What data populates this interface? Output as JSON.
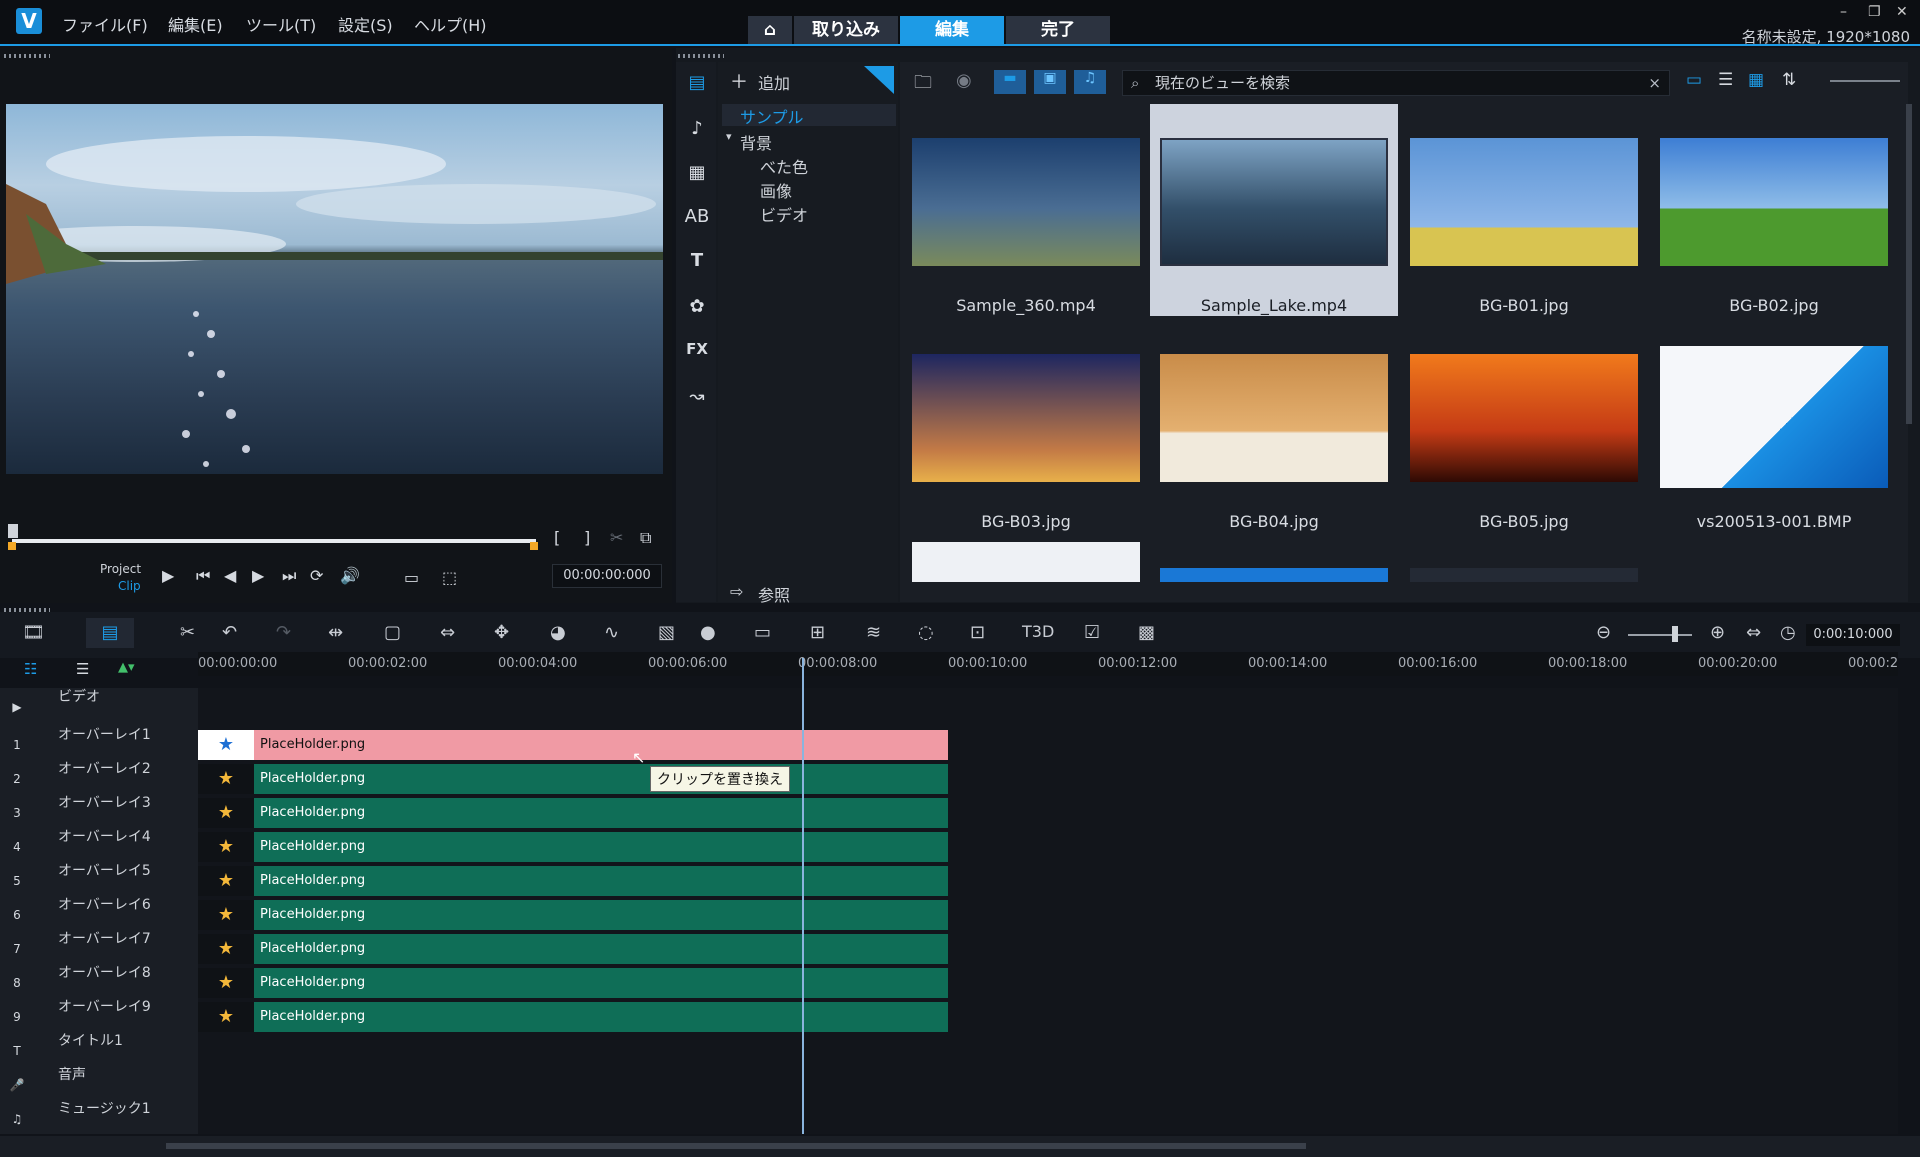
{
  "titlebar": {
    "menus": [
      "ファイル(F)",
      "編集(E)",
      "ツール(T)",
      "設定(S)",
      "ヘルプ(H)"
    ],
    "modes": {
      "home": "⌂",
      "capture": "取り込み",
      "edit": "編集",
      "share": "完了"
    },
    "project_info": "名称未設定, 1920*1080",
    "window_controls": [
      "–",
      "❐",
      "✕"
    ]
  },
  "player": {
    "mode_project": "Project",
    "mode_clip": "Clip",
    "timecode": "00:00:00:000",
    "mark_in": "[",
    "mark_out": "]"
  },
  "library": {
    "add_label": "追加",
    "tree": {
      "sample": "サンプル",
      "background": "背景",
      "solid": "べた色",
      "image": "画像",
      "video": "ビデオ"
    },
    "browse_label": "参照",
    "search_placeholder": "現在のビューを検索",
    "thumbnails": [
      {
        "name": "Sample_360.mp4",
        "colors": [
          "#1c3f6e",
          "#4a6d93",
          "#7a8a5b"
        ]
      },
      {
        "name": "Sample_Lake.mp4",
        "colors": [
          "#7ea3c4",
          "#33506a",
          "#1e2e40"
        ]
      },
      {
        "name": "BG-B01.jpg",
        "colors": [
          "#5b94d6",
          "#8fb7e8",
          "#d8c451"
        ]
      },
      {
        "name": "BG-B02.jpg",
        "colors": [
          "#3d7ed4",
          "#8fbde8",
          "#4d9a2e"
        ]
      },
      {
        "name": "BG-B03.jpg",
        "colors": [
          "#1d2660",
          "#c37a46",
          "#e8b04a"
        ]
      },
      {
        "name": "BG-B04.jpg",
        "colors": [
          "#c98c49",
          "#e4b070",
          "#f1eadc"
        ]
      },
      {
        "name": "BG-B05.jpg",
        "colors": [
          "#f17a1c",
          "#c53b15",
          "#2e0a04"
        ]
      },
      {
        "name": "vs200513-001.BMP",
        "colors": [
          "#1a8fe3",
          "#f5f7fa",
          "#0a5bb8"
        ]
      }
    ]
  },
  "timeline": {
    "ruler": [
      "00:00:00:00",
      "00:00:02:00",
      "00:00:04:00",
      "00:00:06:00",
      "00:00:08:00",
      "00:00:10:00",
      "00:00:12:00",
      "00:00:14:00",
      "00:00:16:00",
      "00:00:18:00",
      "00:00:20:00",
      "00:00:2"
    ],
    "zoom_time": "0:00:10:000",
    "tracks": [
      {
        "num": "",
        "label": "ビデオ"
      },
      {
        "num": "1",
        "label": "オーバーレイ1"
      },
      {
        "num": "2",
        "label": "オーバーレイ2"
      },
      {
        "num": "3",
        "label": "オーバーレイ3"
      },
      {
        "num": "4",
        "label": "オーバーレイ4"
      },
      {
        "num": "5",
        "label": "オーバーレイ5"
      },
      {
        "num": "6",
        "label": "オーバーレイ6"
      },
      {
        "num": "7",
        "label": "オーバーレイ7"
      },
      {
        "num": "8",
        "label": "オーバーレイ8"
      },
      {
        "num": "9",
        "label": "オーバーレイ9"
      },
      {
        "num": "T",
        "label": "タイトル1"
      },
      {
        "num": "",
        "label": "音声"
      },
      {
        "num": "",
        "label": "ミュージック1"
      }
    ],
    "clips": [
      "PlaceHolder.png",
      "PlaceHolder.png",
      "PlaceHolder.png",
      "PlaceHolder.png",
      "PlaceHolder.png",
      "PlaceHolder.png",
      "PlaceHolder.png",
      "PlaceHolder.png",
      "PlaceHolder.png"
    ],
    "tooltip": "クリップを置き換え",
    "colors": {
      "selected_clip": "#f09aa4",
      "clip": "#0f6e57",
      "accent": "#1d9be6"
    }
  }
}
